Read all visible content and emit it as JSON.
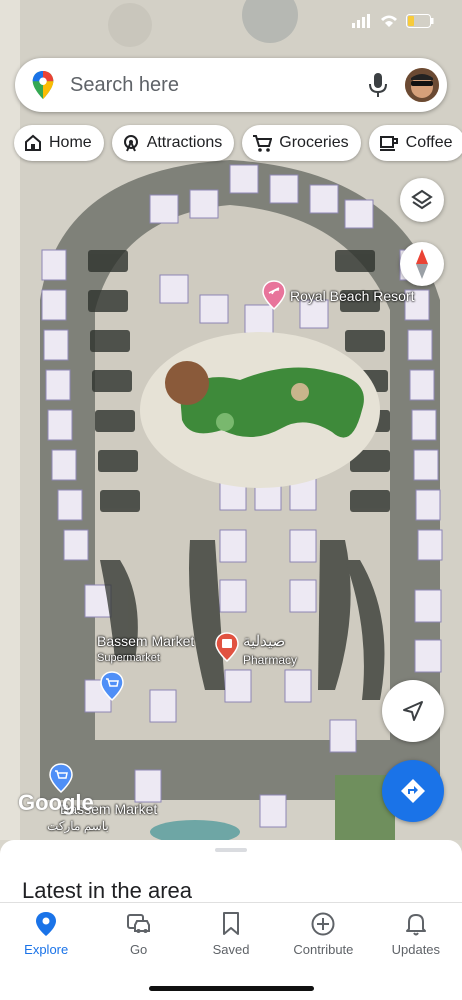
{
  "search": {
    "placeholder": "Search here"
  },
  "chips": [
    {
      "label": "Home",
      "icon": "home-icon"
    },
    {
      "label": "Attractions",
      "icon": "ferris-wheel-icon"
    },
    {
      "label": "Groceries",
      "icon": "cart-icon"
    },
    {
      "label": "Coffee",
      "icon": "coffee-icon"
    }
  ],
  "map": {
    "places": {
      "resort": "Royal Beach Resort",
      "market_name": "Bassem Market",
      "market_type": "Supermarket",
      "pharmacy_arabic": "صيدلية",
      "pharmacy": "Pharmacy",
      "market2": "Bassem Market",
      "market2_arabic": "باسم ماركت"
    },
    "attribution": "Google"
  },
  "sheet": {
    "title": "Latest in the area"
  },
  "nav": {
    "items": [
      {
        "label": "Explore",
        "icon": "explore-pin-icon",
        "active": true
      },
      {
        "label": "Go",
        "icon": "car-icon",
        "active": false
      },
      {
        "label": "Saved",
        "icon": "bookmark-icon",
        "active": false
      },
      {
        "label": "Contribute",
        "icon": "plus-circle-icon",
        "active": false
      },
      {
        "label": "Updates",
        "icon": "bell-icon",
        "active": false
      }
    ]
  },
  "colors": {
    "accent": "#1a73e8",
    "resort_pin": "#e8749b",
    "pharmacy_pin": "#e15241",
    "market_pin": "#4f8ff7"
  }
}
